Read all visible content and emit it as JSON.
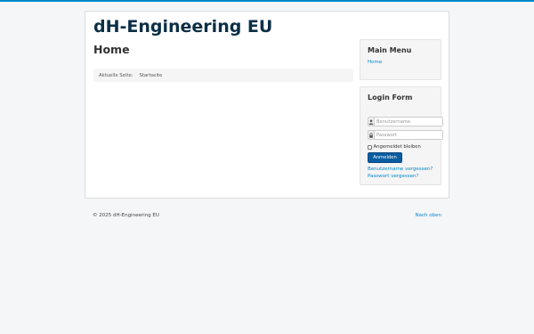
{
  "site": {
    "title": "dH-Engineering EU"
  },
  "main": {
    "heading": "Home",
    "breadcrumb": {
      "label": "Aktuelle Seite:",
      "current": "Startseite"
    }
  },
  "menu_module": {
    "title": "Main Menu",
    "items": [
      {
        "label": "Home"
      }
    ]
  },
  "login_module": {
    "title": "Login Form",
    "username_placeholder": "Benutzername",
    "password_placeholder": "Passwort",
    "remember_label": "Angemeldet bleiben",
    "submit_label": "Anmelden",
    "forgot_username": "Benutzername vergessen?",
    "forgot_password": "Passwort vergessen?"
  },
  "footer": {
    "copyright": "© 2025 dH-Engineering EU",
    "back_to_top": "Nach oben"
  },
  "colors": {
    "accent": "#0088cc",
    "title": "#0b2f45",
    "button": "#0b5da1",
    "link": "#0088cc",
    "background": "#f4f6f7"
  },
  "icons": {
    "username": "user-icon",
    "password": "lock-icon"
  }
}
